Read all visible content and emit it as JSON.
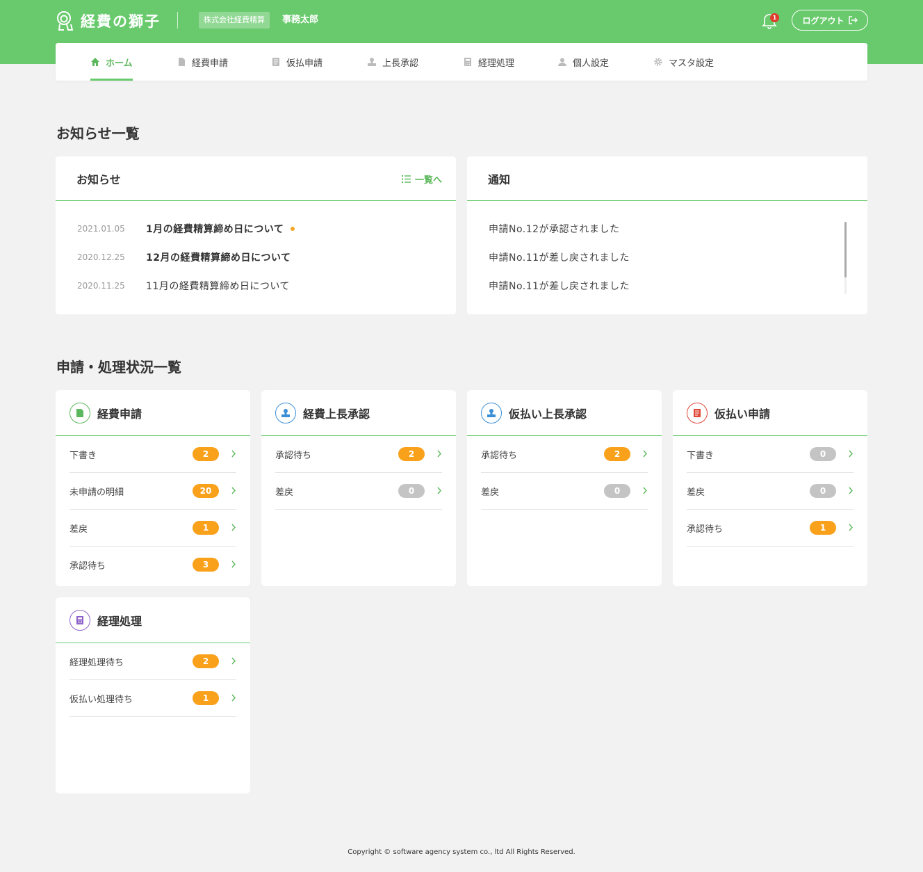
{
  "app": {
    "logo_text": "経費の獅子",
    "company": "株式会社経費精算",
    "user_name": "事務太郎",
    "notification_count": "1",
    "logout_label": "ログアウト"
  },
  "nav": {
    "items": [
      {
        "label": "ホーム",
        "icon": "home-icon",
        "active": true
      },
      {
        "label": "経費申請",
        "icon": "document-icon"
      },
      {
        "label": "仮払申請",
        "icon": "receipt-icon"
      },
      {
        "label": "上長承認",
        "icon": "stamp-icon"
      },
      {
        "label": "経理処理",
        "icon": "calculator-icon"
      },
      {
        "label": "個人設定",
        "icon": "person-icon"
      },
      {
        "label": "マスタ設定",
        "icon": "gear-icon"
      }
    ]
  },
  "notices_section": {
    "title": "お知らせ一覧",
    "news": {
      "title": "お知らせ",
      "link_label": "一覧へ",
      "items": [
        {
          "date": "2021.01.05",
          "title": "1月の経費精算締め日について",
          "unread": true
        },
        {
          "date": "2020.12.25",
          "title": "12月の経費精算締め日について",
          "unread": true
        },
        {
          "date": "2020.11.25",
          "title": "11月の経費精算締め日について",
          "unread": false
        }
      ]
    },
    "notifications": {
      "title": "通知",
      "items": [
        "申請No.12が承認されました",
        "申請No.11が差し戻されました",
        "申請No.11が差し戻されました"
      ]
    }
  },
  "status_section": {
    "title": "申請・処理状況一覧",
    "cards": [
      {
        "title": "経費申請",
        "icon": "document-icon",
        "color": "#5cb85c",
        "rows": [
          {
            "label": "下書き",
            "count": "2",
            "tone": "orange"
          },
          {
            "label": "未申請の明細",
            "count": "20",
            "tone": "orange"
          },
          {
            "label": "差戻",
            "count": "1",
            "tone": "orange"
          },
          {
            "label": "承認待ち",
            "count": "3",
            "tone": "orange"
          }
        ]
      },
      {
        "title": "経費上長承認",
        "icon": "stamp-icon",
        "color": "#3a8fd6",
        "rows": [
          {
            "label": "承認待ち",
            "count": "2",
            "tone": "orange"
          },
          {
            "label": "差戻",
            "count": "0",
            "tone": "grey"
          }
        ]
      },
      {
        "title": "仮払い上長承認",
        "icon": "stamp-icon",
        "color": "#3a8fd6",
        "rows": [
          {
            "label": "承認待ち",
            "count": "2",
            "tone": "orange"
          },
          {
            "label": "差戻",
            "count": "0",
            "tone": "grey"
          }
        ]
      },
      {
        "title": "仮払い申請",
        "icon": "receipt-icon",
        "color": "#e0483a",
        "rows": [
          {
            "label": "下書き",
            "count": "0",
            "tone": "grey"
          },
          {
            "label": "差戻",
            "count": "0",
            "tone": "grey"
          },
          {
            "label": "承認待ち",
            "count": "1",
            "tone": "orange"
          }
        ]
      },
      {
        "title": "経理処理",
        "icon": "calculator-icon",
        "color": "#8e62c9",
        "rows": [
          {
            "label": "経理処理待ち",
            "count": "2",
            "tone": "orange"
          },
          {
            "label": "仮払い処理待ち",
            "count": "1",
            "tone": "orange"
          }
        ]
      }
    ]
  },
  "footer": {
    "text": "Copyright © software agency system co., ltd All Rights Reserved."
  },
  "colors": {
    "brand": "#69ca6d",
    "accent_text": "#5cb85c",
    "badge_orange": "#f9a11b",
    "badge_grey": "#c4c4c4"
  }
}
